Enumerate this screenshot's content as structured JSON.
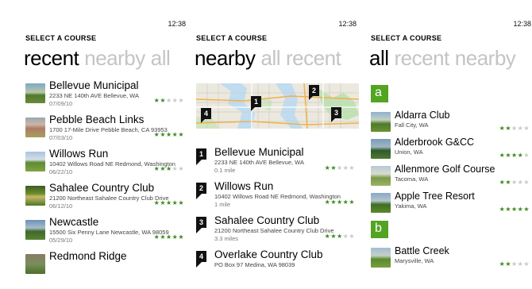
{
  "screens": [
    {
      "clock": "12:38",
      "app_title": "SELECT A COURSE",
      "pivot": [
        "recent",
        "nearby",
        "all"
      ],
      "items": [
        {
          "name": "Bellevue Municipal",
          "address": "2233 NE 140th AVE Bellevue, WA",
          "date": "07/09/10",
          "rating": 2,
          "thumb": "course-thumbnail"
        },
        {
          "name": "Pebble Beach Links",
          "address": "1700 17-Mile Drive Pebble Beach, CA 93953",
          "date": "07/03/10",
          "rating": 5,
          "thumb": "course-thumbnail"
        },
        {
          "name": "Willows Run",
          "address": "10402 Willows Road NE Redmond, Washington",
          "date": "06/22/10",
          "rating": 3,
          "thumb": "course-thumbnail"
        },
        {
          "name": "Sahalee Country Club",
          "address": "21200 Northeast Sahalee Country Club Drive",
          "date": "06/12/10",
          "rating": 5,
          "thumb": "course-thumbnail"
        },
        {
          "name": "Newcastle",
          "address": "15500 Six Penny Lane Newcastle, WA 98059",
          "date": "05/29/10",
          "rating": 5,
          "thumb": "course-thumbnail"
        },
        {
          "name": "Redmond Ridge",
          "address": "",
          "date": "",
          "rating": 0,
          "thumb": "course-thumbnail"
        }
      ]
    },
    {
      "clock": "12:38",
      "app_title": "SELECT A COURSE",
      "pivot": [
        "nearby",
        "all",
        "recent"
      ],
      "map_pins": [
        "1",
        "2",
        "3",
        "4"
      ],
      "items": [
        {
          "num": "1",
          "name": "Bellevue Municipal",
          "address": "2233 NE 140th AVE Bellevue, WA",
          "distance": "0.1 mile",
          "rating": 2
        },
        {
          "num": "2",
          "name": "Willows Run",
          "address": "10402 Willows Road NE Redmond, Washington",
          "distance": "1 mile",
          "rating": 5
        },
        {
          "num": "3",
          "name": "Sahalee Country Club",
          "address": "21200 Northeast Sahalee Country Club Drive",
          "distance": "3.3 miles",
          "rating": 3
        },
        {
          "num": "4",
          "name": "Overlake Country Club",
          "address": "PO Box 97 Medina, WA 98039",
          "distance": "",
          "rating": 0
        }
      ]
    },
    {
      "clock": "12:38",
      "app_title": "SELECT A COURSE",
      "pivot": [
        "all",
        "recent",
        "nearby"
      ],
      "groups": [
        {
          "letter": "a",
          "items": [
            {
              "name": "Aldarra Club",
              "location": "Fall City, WA",
              "rating": 2
            },
            {
              "name": "Alderbrook G&CC",
              "location": "Union, WA",
              "rating": 4
            },
            {
              "name": "Allenmore Golf Course",
              "location": "Tacoma, WA",
              "rating": 2
            },
            {
              "name": "Apple Tree Resort",
              "location": "Yakima, WA",
              "rating": 5
            }
          ]
        },
        {
          "letter": "b",
          "items": [
            {
              "name": "Battle Creek",
              "location": "Marysville, WA",
              "rating": 2
            }
          ]
        }
      ]
    }
  ],
  "colors": {
    "accent": "#52a421",
    "star_on": "#3b8a1c",
    "star_off": "#c8c8c8",
    "inactive_pivot": "#c4c4c4"
  }
}
